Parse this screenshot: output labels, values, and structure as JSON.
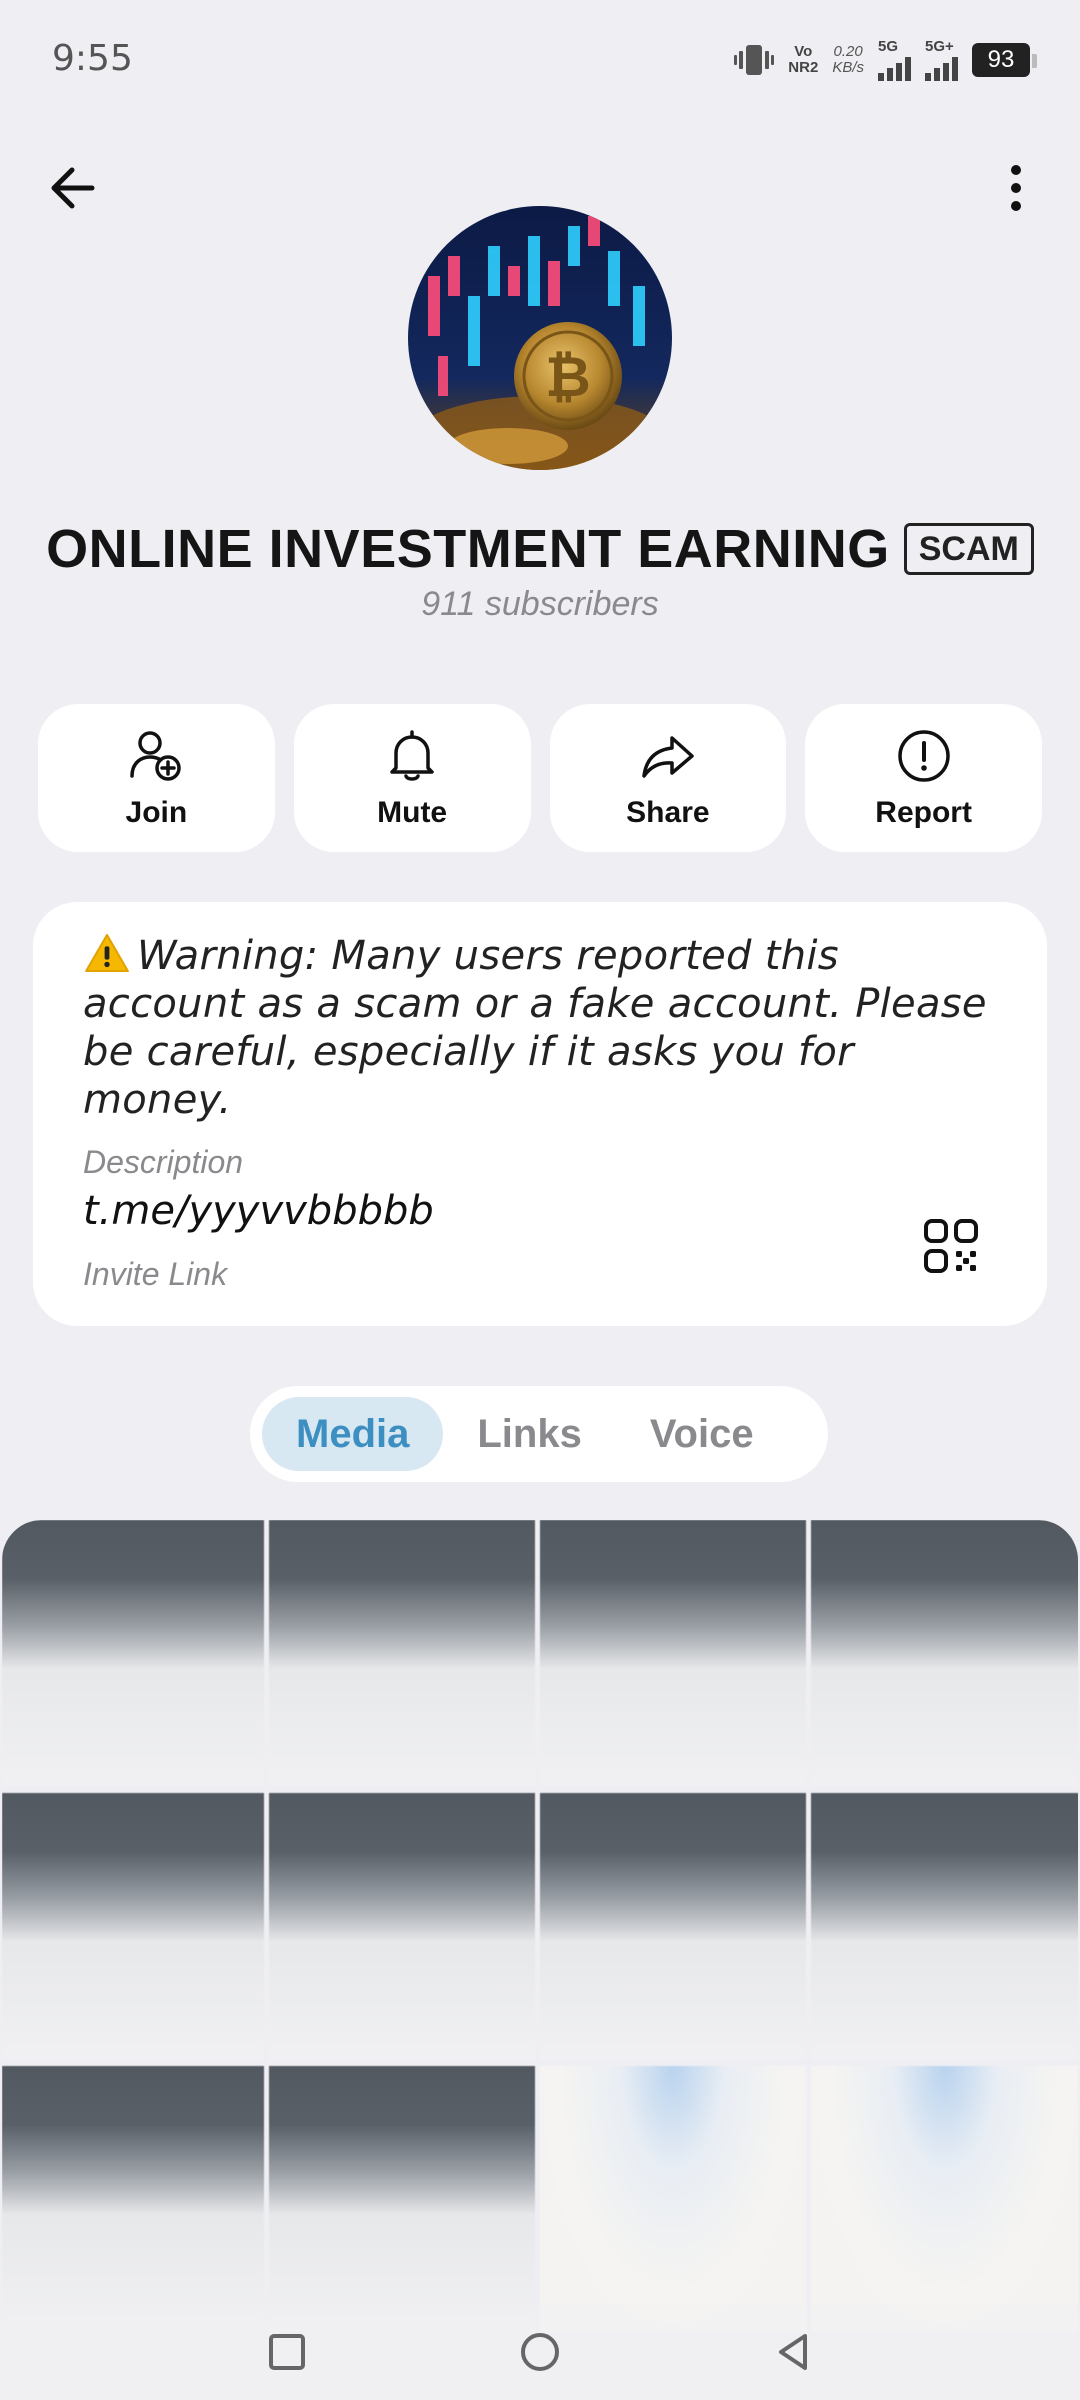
{
  "status_bar": {
    "time": "9:55",
    "volte_top": "Vo",
    "volte_bottom": "NR2",
    "speed_value": "0.20",
    "speed_unit": "KB/s",
    "sim1": "5G",
    "sim2": "5G+",
    "battery": "93"
  },
  "header": {
    "title": "ONLINE INVESTMENT EARNING",
    "badge": "SCAM",
    "subscribers": "911 subscribers"
  },
  "actions": [
    {
      "label": "Join",
      "icon": "add-user-icon"
    },
    {
      "label": "Mute",
      "icon": "bell-icon"
    },
    {
      "label": "Share",
      "icon": "share-arrow-icon"
    },
    {
      "label": "Report",
      "icon": "alert-circle-icon"
    }
  ],
  "info": {
    "warning": "Warning: Many users reported this account as a scam or a fake account. Please be careful, especially if it asks you for money.",
    "description_label": "Description",
    "invite_link": "t.me/yyyvvbbbbb",
    "invite_label": "Invite Link"
  },
  "tabs": [
    {
      "label": "Media",
      "active": true
    },
    {
      "label": "Links",
      "active": false
    },
    {
      "label": "Voice",
      "active": false
    }
  ],
  "colors": {
    "accent": "#3d8fc1",
    "tab_active_bg": "#d8e8f2",
    "background": "#efeff3"
  }
}
